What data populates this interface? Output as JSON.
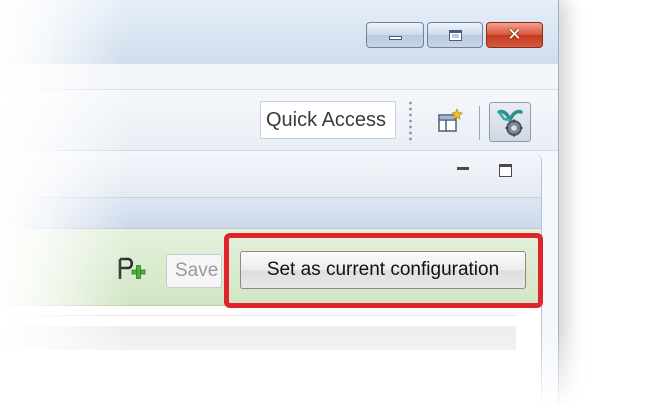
{
  "window": {
    "caption_buttons": {
      "minimize_icon": "minimize-icon",
      "maximize_icon": "maximize-icon",
      "close_icon": "close-icon",
      "close_glyph": "✕"
    }
  },
  "toolbar": {
    "quick_access_label": "Quick Access",
    "open_perspective_icon": "open-perspective-icon",
    "active_perspective_icon": "configuration-perspective-icon"
  },
  "view": {
    "minimize_icon": "view-minimize-icon",
    "maximize_icon": "view-maximize-icon"
  },
  "configuration_bar": {
    "add_icon": "add-configuration-icon",
    "save_label": "Save",
    "set_current_label": "Set as current configuration",
    "highlight_color": "#e0242b"
  }
}
